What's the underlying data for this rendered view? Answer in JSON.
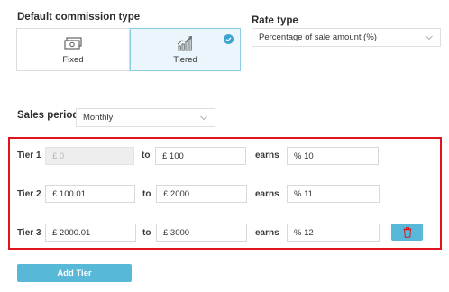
{
  "commission": {
    "title": "Default commission type",
    "options": [
      {
        "label": "Fixed",
        "icon": "cash-icon",
        "selected": false
      },
      {
        "label": "Tiered",
        "icon": "growth-chart-icon",
        "selected": true
      }
    ]
  },
  "rate_type": {
    "title": "Rate type",
    "value": "Percentage of sale amount (%)"
  },
  "sales_period": {
    "title": "Sales period",
    "value": "Monthly"
  },
  "tiers": {
    "to_word": "to",
    "earns_word": "earns",
    "rows": [
      {
        "label": "Tier 1",
        "from": "£ 0",
        "to": "£ 100",
        "rate": "% 10"
      },
      {
        "label": "Tier 2",
        "from": "£ 100.01",
        "to": "£ 2000",
        "rate": "% 11"
      },
      {
        "label": "Tier 3",
        "from": "£ 2000.01",
        "to": "£ 3000",
        "rate": "% 12"
      }
    ]
  },
  "add_tier_label": "Add Tier",
  "colors": {
    "accent": "#58b8d8",
    "check": "#3aa3d1",
    "highlight_border": "#e0141e",
    "delete_icon": "#e0141e"
  }
}
